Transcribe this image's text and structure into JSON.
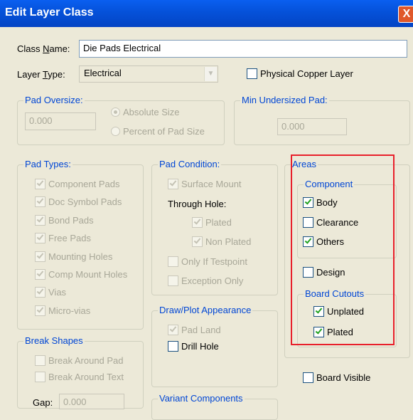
{
  "window": {
    "title": "Edit Layer Class",
    "close_glyph": "X"
  },
  "class_name": {
    "label": "Class Name:",
    "value": "Die Pads Electrical"
  },
  "layer_type": {
    "label": "Layer Type:",
    "value": "Electrical"
  },
  "physical_copper": {
    "label": "Physical Copper Layer",
    "checked": false
  },
  "pad_oversize": {
    "title": "Pad Oversize:",
    "value": "0.000",
    "options": [
      "Absolute Size",
      "Percent of Pad Size"
    ],
    "selected": "Absolute Size"
  },
  "min_undersized": {
    "title": "Min Undersized Pad:",
    "value": "0.000"
  },
  "pad_types": {
    "title": "Pad Types:",
    "items": [
      "Component Pads",
      "Doc Symbol Pads",
      "Bond Pads",
      "Free Pads",
      "Mounting Holes",
      "Comp Mount Holes",
      "Vias",
      "Micro-vias"
    ]
  },
  "pad_condition": {
    "title": "Pad Condition:",
    "surface_mount": "Surface Mount",
    "through_hole": "Through Hole:",
    "plated": "Plated",
    "non_plated": "Non Plated",
    "only_if_testpoint": "Only If Testpoint",
    "exception_only": "Exception Only"
  },
  "draw_plot": {
    "title": "Draw/Plot Appearance",
    "pad_land": "Pad Land",
    "drill_hole": "Drill Hole"
  },
  "areas": {
    "title": "Areas",
    "component": {
      "title": "Component",
      "body": "Body",
      "clearance": "Clearance",
      "others": "Others"
    },
    "design": "Design",
    "board_cutouts": {
      "title": "Board Cutouts",
      "unplated": "Unplated",
      "plated": "Plated"
    }
  },
  "board_visible": "Board Visible",
  "break_shapes": {
    "title": "Break Shapes",
    "around_pad": "Break Around Pad",
    "around_text": "Break Around Text",
    "gap_label": "Gap:",
    "gap_value": "0.000"
  },
  "variant_components": {
    "title": "Variant Components"
  },
  "colors": {
    "title_bar": "#0551d9",
    "dialog": "#ece9d8",
    "highlight": "#e8202b",
    "check": "#21a121"
  }
}
